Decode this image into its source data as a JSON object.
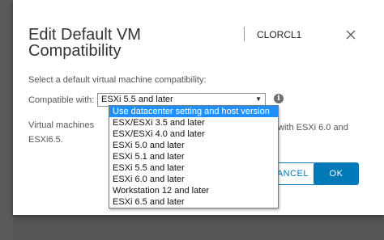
{
  "dialog": {
    "title": "Edit Default VM Compatibility",
    "object_name": "CLORCL1",
    "close_icon": "close-icon",
    "instruction": "Select a default virtual machine compatibility:",
    "compat_label": "Compatible with:",
    "selected_value": "ESXi 5.5 and later",
    "info_icon": "info-icon",
    "description_line1_left": "Virtual machines",
    "description_line1_right": "with ESXi 6.0 and",
    "description_line2": "ESXi6.5.",
    "cancel_label": "CANCEL",
    "ok_label": "OK",
    "accent_color": "#0079b8"
  },
  "dropdown": {
    "options": [
      "Use datacenter setting and host version",
      "ESX/ESXi 3.5 and later",
      "ESX/ESXi 4.0 and later",
      "ESXi 5.0 and later",
      "ESXi 5.1 and later",
      "ESXi 5.5 and later",
      "ESXi 6.0 and later",
      "Workstation 12 and later",
      "ESXi 6.5 and later"
    ],
    "highlighted_index": 0,
    "highlight_color": "#1e90ff"
  }
}
